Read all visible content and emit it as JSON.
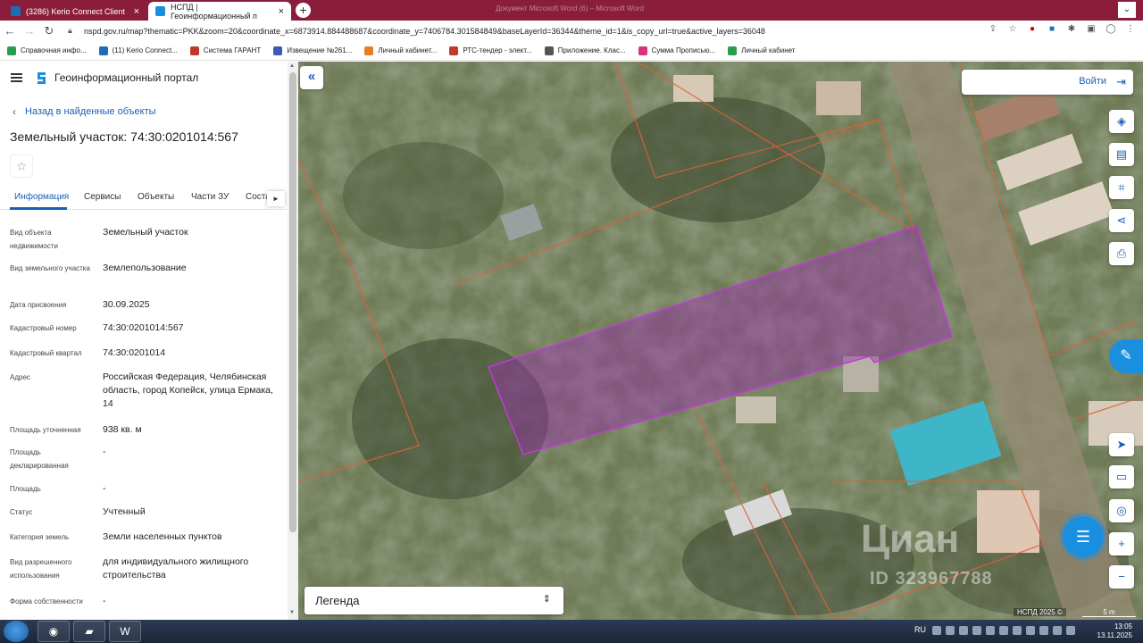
{
  "browser": {
    "tabs": [
      {
        "label": "(3286) Kerio Connect Client",
        "icon": "kerio-icon",
        "color": "#1a6fb4"
      },
      {
        "label": "НСПД | Геоинформационный п",
        "icon": "nspd-icon",
        "color": "#1a8fe0"
      }
    ],
    "window_title_ghost": "Документ Microsoft Word (6) – Microsoft Word",
    "url": "nspd.gov.ru/map?thematic=PKK&zoom=20&coordinate_x=6873914.884488687&coordinate_y=7406784.301584849&baseLayerId=36344&theme_id=1&is_copy_url=true&active_layers=36048",
    "bookmarks": [
      {
        "label": "Справочная инфо...",
        "color": "#2a9d4a"
      },
      {
        "label": "(11) Kerio Connect...",
        "color": "#1a6fb4"
      },
      {
        "label": "Система ГАРАНТ",
        "color": "#c0392b"
      },
      {
        "label": "Извещение №261...",
        "color": "#3b5bb5"
      },
      {
        "label": "Личный кабинет...",
        "color": "#e67e22"
      },
      {
        "label": "РТС-тендер - элект...",
        "color": "#c0392b"
      },
      {
        "label": "Приложение. Клас...",
        "color": "#555555"
      },
      {
        "label": "Сумма Прописью...",
        "color": "#d6337a"
      },
      {
        "label": "Личный кабинет",
        "color": "#2a9d4a"
      }
    ]
  },
  "panel": {
    "portal_name": "Геоинформационный портал",
    "back_label": "Назад в найденные объекты",
    "object_title": "Земельный участок: 74:30:0201014:567",
    "tabs": [
      "Информация",
      "Сервисы",
      "Объекты",
      "Части ЗУ",
      "Соста"
    ],
    "fields": [
      {
        "label": "Вид объекта недвижимости",
        "value": "Земельный участок"
      },
      {
        "label": "Вид земельного участка",
        "value": "Землепользование"
      },
      {
        "label": "Дата присвоения",
        "value": "30.09.2025"
      },
      {
        "label": "Кадастровый номер",
        "value": "74:30:0201014:567"
      },
      {
        "label": "Кадастровый квартал",
        "value": "74:30:0201014"
      },
      {
        "label": "Адрес",
        "value": "Российская Федерация, Челябинская область, город Копейск, улица Ермака, 14"
      },
      {
        "label": "Площадь уточненная",
        "value": "938 кв. м"
      },
      {
        "label": "Площадь декларированная",
        "value": "-"
      },
      {
        "label": "Площадь",
        "value": "-"
      },
      {
        "label": "Статус",
        "value": "Учтенный"
      },
      {
        "label": "Категория земель",
        "value": "Земли населенных пунктов"
      },
      {
        "label": "Вид разрешенного использования",
        "value": "для индивидуального жилищного строительства"
      },
      {
        "label": "Форма собственности",
        "value": "-"
      }
    ]
  },
  "map": {
    "login_label": "Войти",
    "legend_label": "Легенда",
    "copyright": "НСПД 2025 ©",
    "scale_label": "5 m",
    "watermark": "Циан",
    "watermark_id": "ID 323967788",
    "parcel_highlight_color": "#b02bc4"
  },
  "taskbar": {
    "lang": "RU",
    "time": "13:05",
    "date": "13.11.2025"
  }
}
